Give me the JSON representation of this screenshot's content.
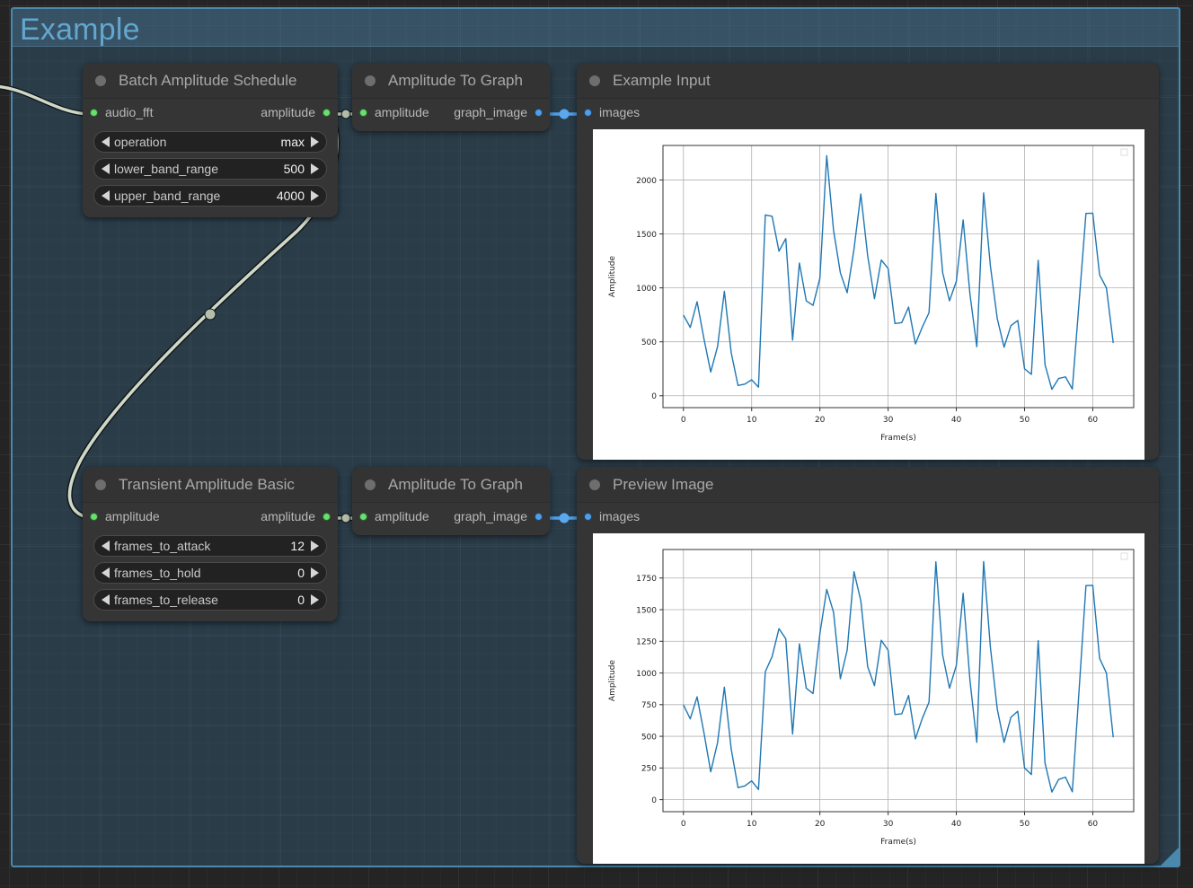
{
  "group": {
    "title": "Example",
    "accent_color": "#4a88ad",
    "fill_color": "#2e4c60"
  },
  "nodes": {
    "batch_amplitude_schedule": {
      "title": "Batch Amplitude Schedule",
      "inputs": [
        {
          "name": "audio_fft",
          "type": "AUDIO_FFT",
          "color": "#68e06e"
        }
      ],
      "outputs": [
        {
          "name": "amplitude",
          "type": "NORMALIZED_AMPLITUDE",
          "color": "#68e06e"
        }
      ],
      "widgets": [
        {
          "name": "operation",
          "value": "max"
        },
        {
          "name": "lower_band_range",
          "value": "500"
        },
        {
          "name": "upper_band_range",
          "value": "4000"
        }
      ]
    },
    "amplitude_to_graph_top": {
      "title": "Amplitude To Graph",
      "inputs": [
        {
          "name": "amplitude",
          "type": "NORMALIZED_AMPLITUDE",
          "color": "#68e06e"
        }
      ],
      "outputs": [
        {
          "name": "graph_image",
          "type": "IMAGE",
          "color": "#4e9ee8"
        }
      ]
    },
    "example_input": {
      "title": "Example Input",
      "inputs": [
        {
          "name": "images",
          "type": "IMAGE",
          "color": "#4e9ee8"
        }
      ]
    },
    "transient_amplitude_basic": {
      "title": "Transient Amplitude Basic",
      "inputs": [
        {
          "name": "amplitude",
          "type": "NORMALIZED_AMPLITUDE",
          "color": "#68e06e"
        }
      ],
      "outputs": [
        {
          "name": "amplitude",
          "type": "NORMALIZED_AMPLITUDE",
          "color": "#68e06e"
        }
      ],
      "widgets": [
        {
          "name": "frames_to_attack",
          "value": "12"
        },
        {
          "name": "frames_to_hold",
          "value": "0"
        },
        {
          "name": "frames_to_release",
          "value": "0"
        }
      ]
    },
    "amplitude_to_graph_bottom": {
      "title": "Amplitude To Graph",
      "inputs": [
        {
          "name": "amplitude",
          "type": "NORMALIZED_AMPLITUDE",
          "color": "#68e06e"
        }
      ],
      "outputs": [
        {
          "name": "graph_image",
          "type": "IMAGE",
          "color": "#4e9ee8"
        }
      ]
    },
    "preview_image": {
      "title": "Preview Image",
      "inputs": [
        {
          "name": "images",
          "type": "IMAGE",
          "color": "#4e9ee8"
        }
      ]
    }
  },
  "chart_data": [
    {
      "id": "example_input_chart",
      "type": "line",
      "title": "",
      "xlabel": "Frame(s)",
      "ylabel": "Amplitude",
      "line_color": "#1f77b4",
      "grid": true,
      "legend": "none",
      "xlim": [
        -3,
        66
      ],
      "ylim": [
        -110,
        2320
      ],
      "xticks": [
        0,
        10,
        20,
        30,
        40,
        50,
        60
      ],
      "yticks": [
        0,
        500,
        1000,
        1500,
        2000
      ],
      "x": [
        0,
        1,
        2,
        3,
        4,
        5,
        6,
        7,
        8,
        9,
        10,
        11,
        12,
        13,
        14,
        15,
        16,
        17,
        18,
        19,
        20,
        21,
        22,
        23,
        24,
        25,
        26,
        27,
        28,
        29,
        30,
        31,
        32,
        33,
        34,
        35,
        36,
        37,
        38,
        39,
        40,
        41,
        42,
        43,
        44,
        45,
        46,
        47,
        48,
        49,
        50,
        51,
        52,
        53,
        54,
        55,
        56,
        57,
        58,
        59,
        60,
        61,
        62,
        63
      ],
      "values": [
        748,
        633,
        872,
        530,
        220,
        455,
        968,
        400,
        95,
        108,
        148,
        80,
        1676,
        1663,
        1340,
        1457,
        516,
        1230,
        880,
        838,
        1090,
        2225,
        1535,
        1140,
        955,
        1360,
        1870,
        1300,
        900,
        1258,
        1180,
        670,
        678,
        822,
        480,
        635,
        770,
        1875,
        1140,
        880,
        1060,
        1630,
        940,
        455,
        1880,
        1200,
        715,
        450,
        650,
        698,
        250,
        198,
        1255,
        288,
        60,
        160,
        175,
        62,
        870,
        1690,
        1692,
        1120,
        1000,
        490
      ]
    },
    {
      "id": "preview_image_chart",
      "type": "line",
      "title": "",
      "xlabel": "Frame(s)",
      "ylabel": "Amplitude",
      "line_color": "#1f77b4",
      "grid": true,
      "legend": "none",
      "xlim": [
        -3,
        66
      ],
      "ylim": [
        -95,
        1975
      ],
      "xticks": [
        0,
        10,
        20,
        30,
        40,
        50,
        60
      ],
      "yticks": [
        0,
        250,
        500,
        750,
        1000,
        1250,
        1500,
        1750
      ],
      "x": [
        0,
        1,
        2,
        3,
        4,
        5,
        6,
        7,
        8,
        9,
        10,
        11,
        12,
        13,
        14,
        15,
        16,
        17,
        18,
        19,
        20,
        21,
        22,
        23,
        24,
        25,
        26,
        27,
        28,
        29,
        30,
        31,
        32,
        33,
        34,
        35,
        36,
        37,
        38,
        39,
        40,
        41,
        42,
        43,
        44,
        45,
        46,
        47,
        48,
        49,
        50,
        51,
        52,
        53,
        54,
        55,
        56,
        57,
        58,
        59,
        60,
        61,
        62,
        63
      ],
      "values": [
        748,
        638,
        812,
        530,
        220,
        450,
        888,
        400,
        95,
        108,
        148,
        80,
        1010,
        1130,
        1350,
        1270,
        518,
        1230,
        880,
        838,
        1310,
        1660,
        1480,
        955,
        1180,
        1800,
        1570,
        1050,
        900,
        1258,
        1180,
        672,
        678,
        822,
        480,
        640,
        770,
        1878,
        1140,
        880,
        1060,
        1630,
        940,
        452,
        1880,
        1200,
        715,
        452,
        650,
        698,
        250,
        198,
        1255,
        288,
        60,
        160,
        178,
        62,
        870,
        1690,
        1692,
        1115,
        1000,
        492
      ]
    }
  ]
}
